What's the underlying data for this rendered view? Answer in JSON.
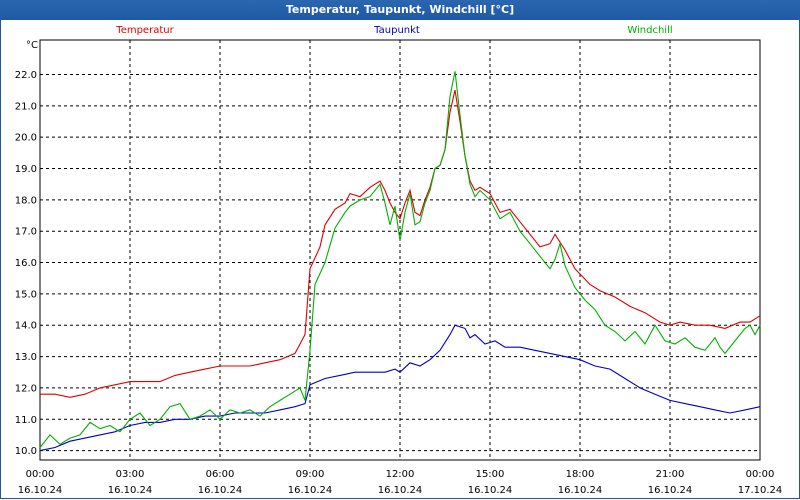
{
  "window": {
    "title": "Temperatur, Taupunkt, Windchill [°C]"
  },
  "chart_data": {
    "type": "line",
    "title": "Temperatur, Taupunkt, Windchill [°C]",
    "y_unit": "°C",
    "ylim": [
      9.7,
      23.1
    ],
    "y_ticks": [
      10.0,
      11.0,
      12.0,
      13.0,
      14.0,
      15.0,
      16.0,
      17.0,
      18.0,
      19.0,
      20.0,
      21.0,
      22.0
    ],
    "x_ticks": [
      {
        "time": "00:00",
        "date": "16.10.24"
      },
      {
        "time": "03:00",
        "date": "16.10.24"
      },
      {
        "time": "06:00",
        "date": "16.10.24"
      },
      {
        "time": "09:00",
        "date": "16.10.24"
      },
      {
        "time": "12:00",
        "date": "16.10.24"
      },
      {
        "time": "15:00",
        "date": "16.10.24"
      },
      {
        "time": "18:00",
        "date": "16.10.24"
      },
      {
        "time": "21:00",
        "date": "16.10.24"
      },
      {
        "time": "00:00",
        "date": "17.10.24"
      }
    ],
    "grid": true,
    "legend_placement": "top",
    "series": [
      {
        "name": "Temperatur",
        "color": "#e00000",
        "points": [
          [
            "16.10.24 00:00",
            11.8
          ],
          [
            "16.10.24 00:30",
            11.8
          ],
          [
            "16.10.24 01:00",
            11.7
          ],
          [
            "16.10.24 01:30",
            11.8
          ],
          [
            "16.10.24 02:00",
            12.0
          ],
          [
            "16.10.24 02:30",
            12.1
          ],
          [
            "16.10.24 03:00",
            12.2
          ],
          [
            "16.10.24 03:30",
            12.2
          ],
          [
            "16.10.24 04:00",
            12.2
          ],
          [
            "16.10.24 04:30",
            12.4
          ],
          [
            "16.10.24 05:00",
            12.5
          ],
          [
            "16.10.24 05:30",
            12.6
          ],
          [
            "16.10.24 06:00",
            12.7
          ],
          [
            "16.10.24 06:30",
            12.7
          ],
          [
            "16.10.24 07:00",
            12.7
          ],
          [
            "16.10.24 07:30",
            12.8
          ],
          [
            "16.10.24 08:00",
            12.9
          ],
          [
            "16.10.24 08:30",
            13.1
          ],
          [
            "16.10.24 08:50",
            13.7
          ],
          [
            "16.10.24 09:00",
            15.8
          ],
          [
            "16.10.24 09:20",
            16.5
          ],
          [
            "16.10.24 09:30",
            17.2
          ],
          [
            "16.10.24 09:50",
            17.7
          ],
          [
            "16.10.24 10:10",
            17.9
          ],
          [
            "16.10.24 10:20",
            18.2
          ],
          [
            "16.10.24 10:40",
            18.1
          ],
          [
            "16.10.24 11:00",
            18.4
          ],
          [
            "16.10.24 11:20",
            18.6
          ],
          [
            "16.10.24 11:30",
            18.3
          ],
          [
            "16.10.24 11:40",
            17.9
          ],
          [
            "16.10.24 11:50",
            17.6
          ],
          [
            "16.10.24 12:00",
            17.4
          ],
          [
            "16.10.24 12:10",
            17.9
          ],
          [
            "16.10.24 12:20",
            18.3
          ],
          [
            "16.10.24 12:30",
            17.6
          ],
          [
            "16.10.24 12:40",
            17.5
          ],
          [
            "16.10.24 12:50",
            18.0
          ],
          [
            "16.10.24 13:00",
            18.4
          ],
          [
            "16.10.24 13:10",
            19.0
          ],
          [
            "16.10.24 13:20",
            19.1
          ],
          [
            "16.10.24 13:30",
            19.6
          ],
          [
            "16.10.24 13:40",
            20.8
          ],
          [
            "16.10.24 13:50",
            21.5
          ],
          [
            "16.10.24 14:00",
            20.5
          ],
          [
            "16.10.24 14:10",
            19.4
          ],
          [
            "16.10.24 14:20",
            18.6
          ],
          [
            "16.10.24 14:30",
            18.3
          ],
          [
            "16.10.24 14:40",
            18.4
          ],
          [
            "16.10.24 15:00",
            18.2
          ],
          [
            "16.10.24 15:20",
            17.6
          ],
          [
            "16.10.24 15:40",
            17.7
          ],
          [
            "16.10.24 16:00",
            17.3
          ],
          [
            "16.10.24 16:20",
            16.9
          ],
          [
            "16.10.24 16:40",
            16.5
          ],
          [
            "16.10.24 17:00",
            16.6
          ],
          [
            "16.10.24 17:10",
            16.9
          ],
          [
            "16.10.24 17:30",
            16.4
          ],
          [
            "16.10.24 17:50",
            15.8
          ],
          [
            "16.10.24 18:20",
            15.3
          ],
          [
            "16.10.24 18:40",
            15.1
          ],
          [
            "16.10.24 19:10",
            14.9
          ],
          [
            "16.10.24 19:40",
            14.6
          ],
          [
            "16.10.24 20:10",
            14.4
          ],
          [
            "16.10.24 20:40",
            14.1
          ],
          [
            "16.10.24 21:00",
            14.0
          ],
          [
            "16.10.24 21:20",
            14.1
          ],
          [
            "16.10.24 21:50",
            14.0
          ],
          [
            "16.10.24 22:20",
            14.0
          ],
          [
            "16.10.24 22:50",
            13.9
          ],
          [
            "16.10.24 23:20",
            14.1
          ],
          [
            "16.10.24 23:40",
            14.1
          ],
          [
            "17.10.24 00:00",
            14.3
          ]
        ]
      },
      {
        "name": "Taupunkt",
        "color": "#0000c8",
        "points": [
          [
            "16.10.24 00:00",
            10.0
          ],
          [
            "16.10.24 00:30",
            10.1
          ],
          [
            "16.10.24 01:00",
            10.3
          ],
          [
            "16.10.24 01:30",
            10.4
          ],
          [
            "16.10.24 02:00",
            10.5
          ],
          [
            "16.10.24 02:30",
            10.6
          ],
          [
            "16.10.24 03:00",
            10.8
          ],
          [
            "16.10.24 03:30",
            10.9
          ],
          [
            "16.10.24 04:00",
            10.9
          ],
          [
            "16.10.24 04:30",
            11.0
          ],
          [
            "16.10.24 05:00",
            11.0
          ],
          [
            "16.10.24 05:30",
            11.1
          ],
          [
            "16.10.24 06:00",
            11.1
          ],
          [
            "16.10.24 06:30",
            11.2
          ],
          [
            "16.10.24 07:00",
            11.2
          ],
          [
            "16.10.24 07:30",
            11.2
          ],
          [
            "16.10.24 08:00",
            11.3
          ],
          [
            "16.10.24 08:30",
            11.4
          ],
          [
            "16.10.24 08:50",
            11.5
          ],
          [
            "16.10.24 09:00",
            12.1
          ],
          [
            "16.10.24 09:30",
            12.3
          ],
          [
            "16.10.24 10:00",
            12.4
          ],
          [
            "16.10.24 10:30",
            12.5
          ],
          [
            "16.10.24 11:00",
            12.5
          ],
          [
            "16.10.24 11:30",
            12.5
          ],
          [
            "16.10.24 11:50",
            12.6
          ],
          [
            "16.10.24 12:00",
            12.5
          ],
          [
            "16.10.24 12:20",
            12.8
          ],
          [
            "16.10.24 12:40",
            12.7
          ],
          [
            "16.10.24 13:00",
            12.9
          ],
          [
            "16.10.24 13:20",
            13.2
          ],
          [
            "16.10.24 13:40",
            13.7
          ],
          [
            "16.10.24 13:50",
            14.0
          ],
          [
            "16.10.24 14:10",
            13.9
          ],
          [
            "16.10.24 14:20",
            13.6
          ],
          [
            "16.10.24 14:30",
            13.7
          ],
          [
            "16.10.24 14:50",
            13.4
          ],
          [
            "16.10.24 15:10",
            13.5
          ],
          [
            "16.10.24 15:30",
            13.3
          ],
          [
            "16.10.24 16:00",
            13.3
          ],
          [
            "16.10.24 16:30",
            13.2
          ],
          [
            "16.10.24 17:00",
            13.1
          ],
          [
            "16.10.24 17:30",
            13.0
          ],
          [
            "16.10.24 18:00",
            12.9
          ],
          [
            "16.10.24 18:30",
            12.7
          ],
          [
            "16.10.24 19:00",
            12.6
          ],
          [
            "16.10.24 19:30",
            12.3
          ],
          [
            "16.10.24 20:00",
            12.0
          ],
          [
            "16.10.24 20:30",
            11.8
          ],
          [
            "16.10.24 21:00",
            11.6
          ],
          [
            "16.10.24 21:30",
            11.5
          ],
          [
            "16.10.24 22:00",
            11.4
          ],
          [
            "16.10.24 22:30",
            11.3
          ],
          [
            "16.10.24 23:00",
            11.2
          ],
          [
            "16.10.24 23:30",
            11.3
          ],
          [
            "17.10.24 00:00",
            11.4
          ]
        ]
      },
      {
        "name": "Windchill",
        "color": "#00b000",
        "points": [
          [
            "16.10.24 00:00",
            10.1
          ],
          [
            "16.10.24 00:20",
            10.5
          ],
          [
            "16.10.24 00:40",
            10.2
          ],
          [
            "16.10.24 01:00",
            10.4
          ],
          [
            "16.10.24 01:20",
            10.5
          ],
          [
            "16.10.24 01:40",
            10.9
          ],
          [
            "16.10.24 02:00",
            10.7
          ],
          [
            "16.10.24 02:20",
            10.8
          ],
          [
            "16.10.24 02:40",
            10.6
          ],
          [
            "16.10.24 03:00",
            11.0
          ],
          [
            "16.10.24 03:20",
            11.2
          ],
          [
            "16.10.24 03:40",
            10.8
          ],
          [
            "16.10.24 04:00",
            11.0
          ],
          [
            "16.10.24 04:20",
            11.4
          ],
          [
            "16.10.24 04:40",
            11.5
          ],
          [
            "16.10.24 05:00",
            11.0
          ],
          [
            "16.10.24 05:20",
            11.1
          ],
          [
            "16.10.24 05:40",
            11.3
          ],
          [
            "16.10.24 06:00",
            11.0
          ],
          [
            "16.10.24 06:20",
            11.3
          ],
          [
            "16.10.24 06:40",
            11.2
          ],
          [
            "16.10.24 07:00",
            11.3
          ],
          [
            "16.10.24 07:20",
            11.1
          ],
          [
            "16.10.24 07:40",
            11.4
          ],
          [
            "16.10.24 08:00",
            11.6
          ],
          [
            "16.10.24 08:20",
            11.8
          ],
          [
            "16.10.24 08:40",
            12.0
          ],
          [
            "16.10.24 08:50",
            11.6
          ],
          [
            "16.10.24 09:00",
            13.2
          ],
          [
            "16.10.24 09:10",
            15.3
          ],
          [
            "16.10.24 09:30",
            16.0
          ],
          [
            "16.10.24 09:50",
            17.1
          ],
          [
            "16.10.24 10:10",
            17.6
          ],
          [
            "16.10.24 10:20",
            17.8
          ],
          [
            "16.10.24 10:40",
            18.0
          ],
          [
            "16.10.24 11:00",
            18.1
          ],
          [
            "16.10.24 11:20",
            18.5
          ],
          [
            "16.10.24 11:30",
            17.9
          ],
          [
            "16.10.24 11:40",
            17.2
          ],
          [
            "16.10.24 11:50",
            17.8
          ],
          [
            "16.10.24 12:00",
            16.7
          ],
          [
            "16.10.24 12:10",
            17.6
          ],
          [
            "16.10.24 12:20",
            18.2
          ],
          [
            "16.10.24 12:30",
            17.2
          ],
          [
            "16.10.24 12:40",
            17.3
          ],
          [
            "16.10.24 12:50",
            17.9
          ],
          [
            "16.10.24 13:00",
            18.3
          ],
          [
            "16.10.24 13:10",
            19.0
          ],
          [
            "16.10.24 13:20",
            19.1
          ],
          [
            "16.10.24 13:30",
            19.6
          ],
          [
            "16.10.24 13:40",
            21.3
          ],
          [
            "16.10.24 13:50",
            22.1
          ],
          [
            "16.10.24 14:00",
            20.7
          ],
          [
            "16.10.24 14:10",
            19.4
          ],
          [
            "16.10.24 14:20",
            18.5
          ],
          [
            "16.10.24 14:30",
            18.1
          ],
          [
            "16.10.24 14:40",
            18.3
          ],
          [
            "16.10.24 15:00",
            18.0
          ],
          [
            "16.10.24 15:20",
            17.4
          ],
          [
            "16.10.24 15:40",
            17.6
          ],
          [
            "16.10.24 16:00",
            17.0
          ],
          [
            "16.10.24 16:20",
            16.6
          ],
          [
            "16.10.24 16:40",
            16.2
          ],
          [
            "16.10.24 17:00",
            15.8
          ],
          [
            "16.10.24 17:10",
            16.1
          ],
          [
            "16.10.24 17:20",
            16.6
          ],
          [
            "16.10.24 17:30",
            15.9
          ],
          [
            "16.10.24 17:50",
            15.2
          ],
          [
            "16.10.24 18:10",
            14.8
          ],
          [
            "16.10.24 18:30",
            14.5
          ],
          [
            "16.10.24 18:50",
            14.0
          ],
          [
            "16.10.24 19:10",
            13.8
          ],
          [
            "16.10.24 19:30",
            13.5
          ],
          [
            "16.10.24 19:50",
            13.8
          ],
          [
            "16.10.24 20:10",
            13.4
          ],
          [
            "16.10.24 20:30",
            14.0
          ],
          [
            "16.10.24 20:50",
            13.5
          ],
          [
            "16.10.24 21:10",
            13.4
          ],
          [
            "16.10.24 21:30",
            13.6
          ],
          [
            "16.10.24 21:50",
            13.3
          ],
          [
            "16.10.24 22:10",
            13.2
          ],
          [
            "16.10.24 22:30",
            13.6
          ],
          [
            "16.10.24 22:40",
            13.3
          ],
          [
            "16.10.24 22:50",
            13.1
          ],
          [
            "16.10.24 23:10",
            13.5
          ],
          [
            "16.10.24 23:30",
            13.9
          ],
          [
            "16.10.24 23:40",
            14.0
          ],
          [
            "16.10.24 23:50",
            13.7
          ],
          [
            "17.10.24 00:00",
            14.0
          ]
        ]
      }
    ]
  }
}
